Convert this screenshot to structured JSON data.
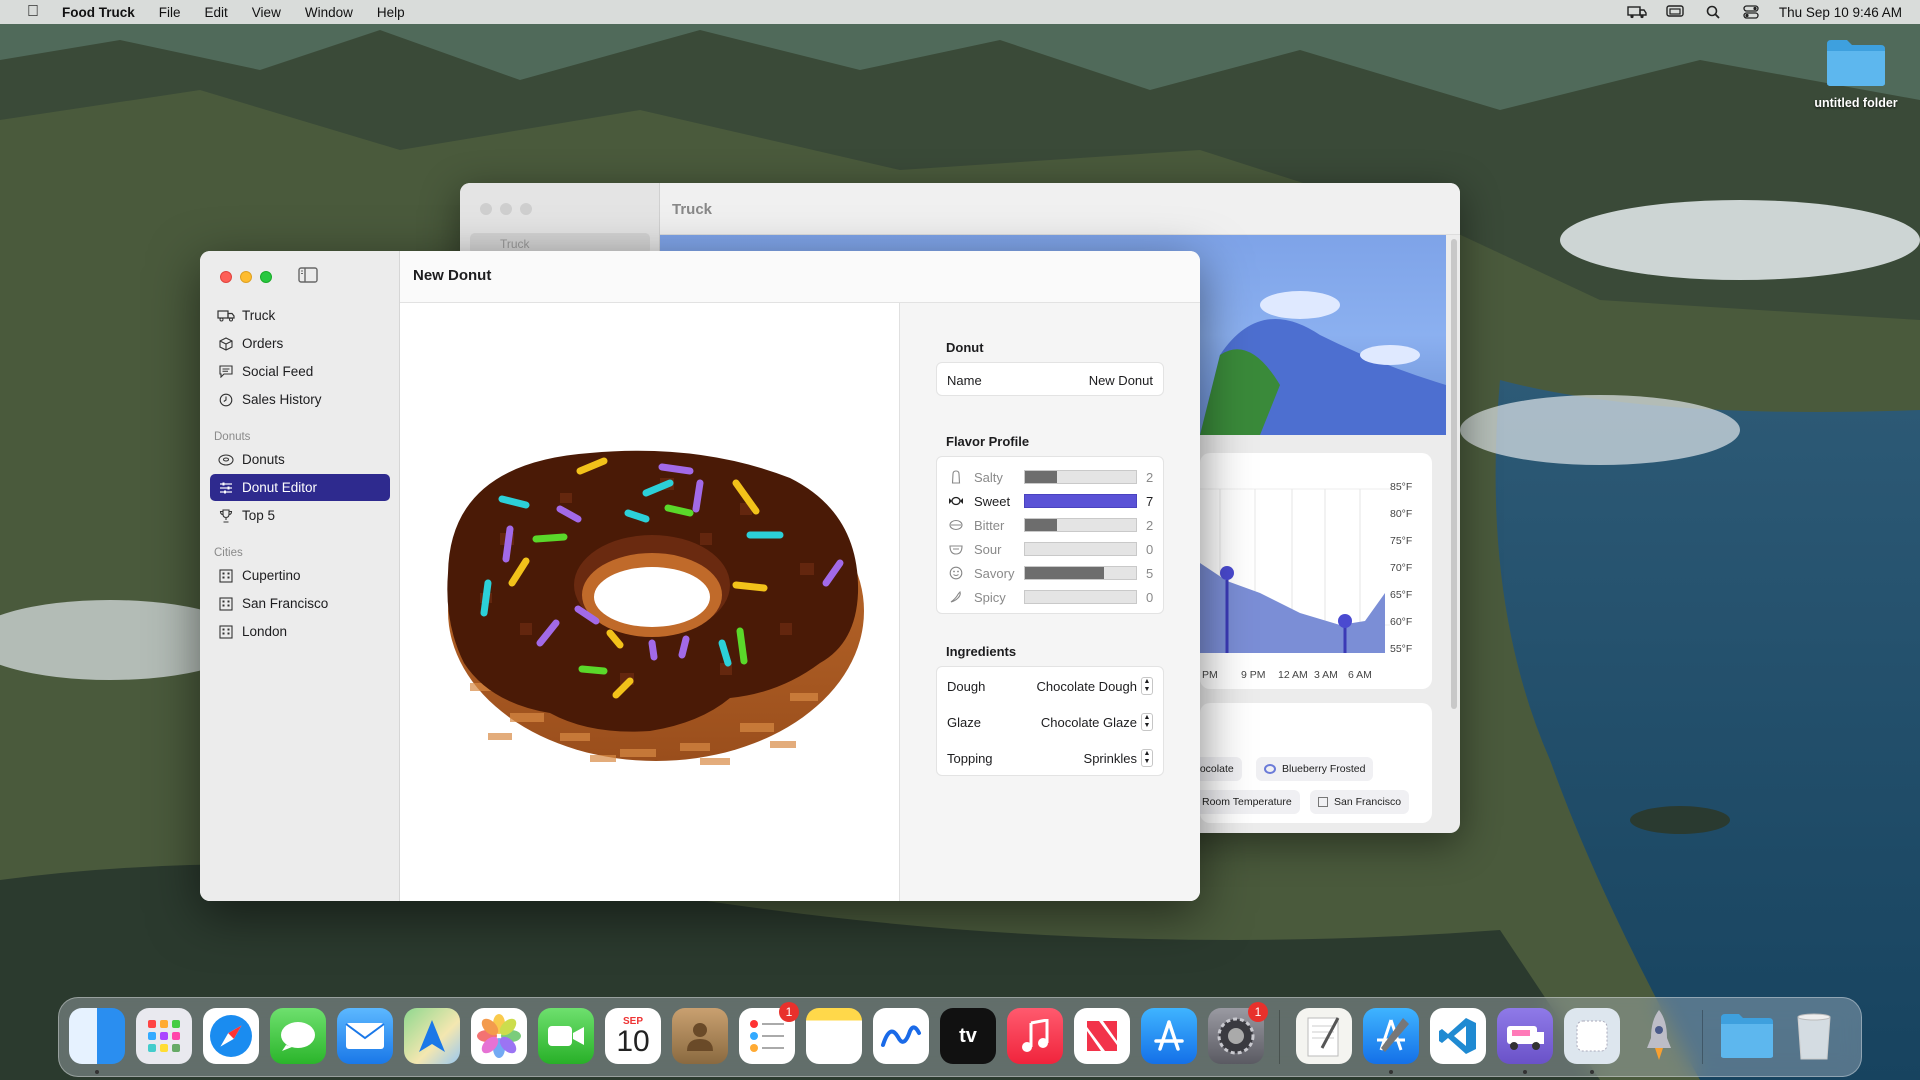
{
  "menubar": {
    "app_name": "Food Truck",
    "menus": [
      "File",
      "Edit",
      "View",
      "Window",
      "Help"
    ],
    "datetime": "Thu Sep 10  9:46 AM"
  },
  "desktop": {
    "folder_label": "untitled folder"
  },
  "back_window": {
    "title": "Truck",
    "sidebar_item": "Truck",
    "temps": [
      "85°F",
      "80°F",
      "75°F",
      "70°F",
      "65°F",
      "60°F",
      "55°F"
    ],
    "times": [
      "PM",
      "9 PM",
      "12 AM",
      "3 AM",
      "6 AM"
    ],
    "chips": [
      "hocolate",
      "Blueberry Frosted",
      "Room Temperature",
      "San Francisco"
    ]
  },
  "main_window": {
    "title": "New Donut",
    "sidebar": {
      "items": [
        "Truck",
        "Orders",
        "Social Feed",
        "Sales History"
      ],
      "donuts_header": "Donuts",
      "donuts_items": [
        "Donuts",
        "Donut Editor",
        "Top 5"
      ],
      "cities_header": "Cities",
      "cities_items": [
        "Cupertino",
        "San Francisco",
        "London"
      ]
    },
    "inspector": {
      "donut_header": "Donut",
      "name_label": "Name",
      "name_value": "New Donut",
      "flavor_header": "Flavor Profile",
      "flavors": [
        {
          "name": "Salty",
          "value": "2",
          "level": 0.2857,
          "icon": "salt-shaker-icon"
        },
        {
          "name": "Sweet",
          "value": "7",
          "level": 1.0,
          "icon": "candy-icon"
        },
        {
          "name": "Bitter",
          "value": "2",
          "level": 0.2857,
          "icon": "leaf-icon"
        },
        {
          "name": "Sour",
          "value": "0",
          "level": 0,
          "icon": "lemon-icon"
        },
        {
          "name": "Savory",
          "value": "5",
          "level": 0.7143,
          "icon": "smiley-icon"
        },
        {
          "name": "Spicy",
          "value": "0",
          "level": 0,
          "icon": "pepper-icon"
        }
      ],
      "ingredients_header": "Ingredients",
      "ingredients": [
        {
          "label": "Dough",
          "value": "Chocolate Dough"
        },
        {
          "label": "Glaze",
          "value": "Chocolate Glaze"
        },
        {
          "label": "Topping",
          "value": "Sprinkles"
        }
      ]
    }
  },
  "dock": {
    "calendar_month": "SEP",
    "calendar_day": "10",
    "reminders_badge": "1",
    "settings_badge": "1",
    "appletv_label": "tv"
  },
  "colors": {
    "accent": "#2e2a8e",
    "sweet_bar": "#5a52d6",
    "glaze": "#4a1a06",
    "dough": "#b8652a"
  }
}
